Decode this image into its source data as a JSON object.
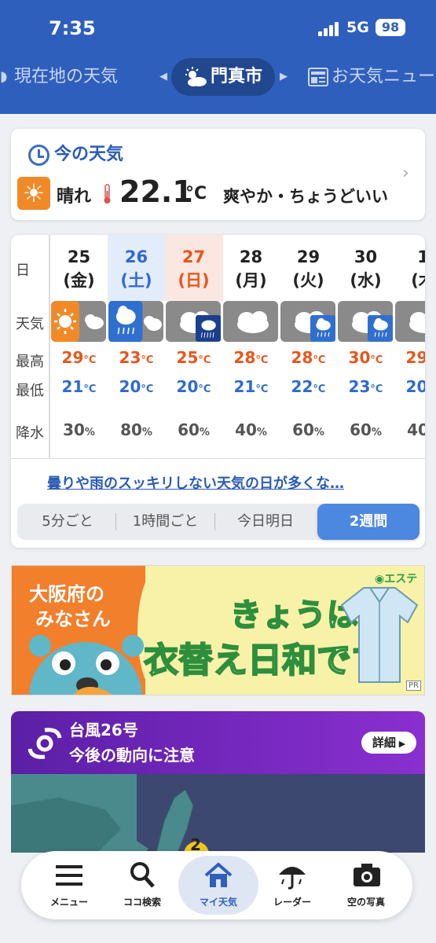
{
  "status": {
    "time": "7:35",
    "network": "5G",
    "battery": "98"
  },
  "tabs": {
    "prev": "現在地の天気",
    "current": "門真市",
    "next": "お天気ニュー"
  },
  "now": {
    "title": "今の天気",
    "condition": "晴れ",
    "temperature": "22.1",
    "temp_unit": "°C",
    "comment": "爽やか・ちょうどいい"
  },
  "forecast": {
    "row_labels": {
      "day": "日",
      "weather": "天気",
      "high": "最高",
      "low": "最低",
      "rain": "降水"
    },
    "temp_unit": "°C",
    "rain_unit": "%",
    "days": [
      {
        "date": "25",
        "dow": "(金)",
        "weather": "sunny-then-cloudy",
        "high": "29",
        "low": "21",
        "rain": "30"
      },
      {
        "date": "26",
        "dow": "(土)",
        "weather": "rain-then-cloudy",
        "high": "23",
        "low": "20",
        "rain": "80"
      },
      {
        "date": "27",
        "dow": "(日)",
        "weather": "cloudy-then-heavy-rain",
        "high": "25",
        "low": "20",
        "rain": "60"
      },
      {
        "date": "28",
        "dow": "(月)",
        "weather": "cloudy",
        "high": "28",
        "low": "21",
        "rain": "40"
      },
      {
        "date": "29",
        "dow": "(火)",
        "weather": "cloudy-then-rain",
        "high": "28",
        "low": "22",
        "rain": "60"
      },
      {
        "date": "30",
        "dow": "(水)",
        "weather": "cloudy-then-rain",
        "high": "30",
        "low": "23",
        "rain": "60"
      },
      {
        "date": "1",
        "dow": "(木",
        "weather": "cloudy",
        "high": "29",
        "low": "20",
        "rain": "40"
      }
    ],
    "link": "曇りや雨のスッキリしない天気の日が多くな…",
    "segments": [
      "5分ごと",
      "1時間ごと",
      "今日明日",
      "2週間"
    ]
  },
  "ad": {
    "left_line1": "大阪府の",
    "left_line2": "みなさん",
    "brand": "エステー",
    "headline1": "きょうは",
    "headline2": "衣替え日和です!",
    "pr": "PR"
  },
  "typhoon": {
    "title": "台風26号",
    "subtitle": "今後の動向に注意",
    "detail": "詳細",
    "map_marker": "2"
  },
  "bottom_nav": [
    {
      "label": "メニュー",
      "icon": "menu-icon"
    },
    {
      "label": "ココ検索",
      "icon": "search-icon"
    },
    {
      "label": "マイ天気",
      "icon": "home-icon"
    },
    {
      "label": "レーダー",
      "icon": "umbrella-icon"
    },
    {
      "label": "空の写真",
      "icon": "camera-icon"
    }
  ],
  "colors": {
    "header": "#2f5fbd",
    "high": "#e8551c",
    "low": "#2e6ad0",
    "saturday_bg": "#e3ecfb",
    "sunday_bg": "#fbe7e1",
    "sun": "#f08a28"
  }
}
